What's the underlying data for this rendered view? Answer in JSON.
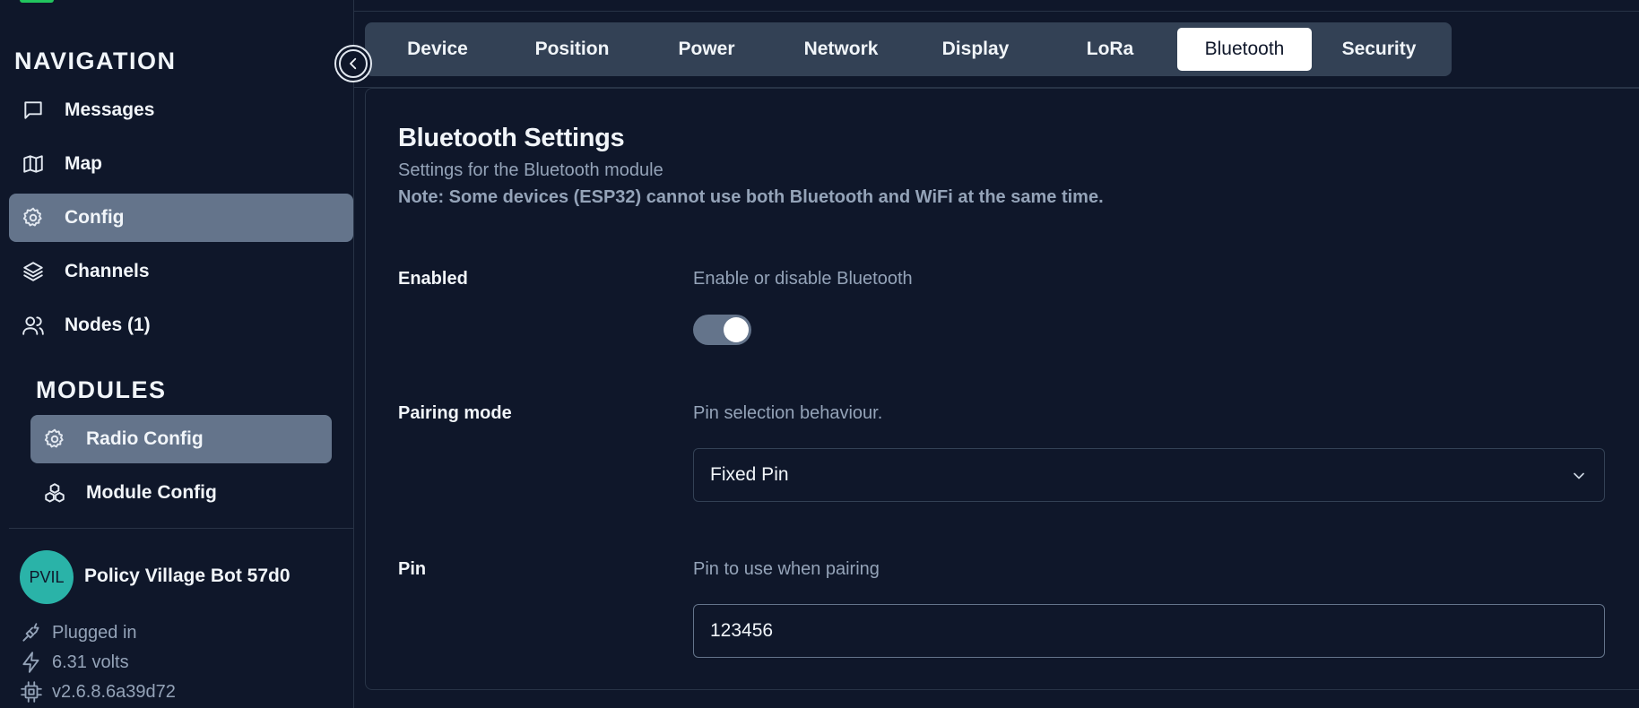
{
  "sidebar": {
    "navigation_title": "NAVIGATION",
    "nav_items": [
      {
        "label": "Messages",
        "icon": "message-square-icon"
      },
      {
        "label": "Map",
        "icon": "map-icon"
      },
      {
        "label": "Config",
        "icon": "gear-icon",
        "active": true
      },
      {
        "label": "Channels",
        "icon": "layers-icon"
      },
      {
        "label": "Nodes (1)",
        "icon": "users-icon"
      }
    ],
    "modules_title": "MODULES",
    "module_items": [
      {
        "label": "Radio Config",
        "icon": "gear-icon",
        "active": true
      },
      {
        "label": "Module Config",
        "icon": "boxes-icon"
      }
    ],
    "device": {
      "avatar_initials": "PVIL",
      "name": "Policy Village Bot 57d0",
      "power_status": "Plugged in",
      "voltage": "6.31 volts",
      "firmware": "v2.6.8.6a39d72"
    }
  },
  "tabs": [
    {
      "label": "Device"
    },
    {
      "label": "Position"
    },
    {
      "label": "Power"
    },
    {
      "label": "Network"
    },
    {
      "label": "Display"
    },
    {
      "label": "LoRa"
    },
    {
      "label": "Bluetooth",
      "active": true
    },
    {
      "label": "Security"
    }
  ],
  "settings": {
    "title": "Bluetooth Settings",
    "subtitle": "Settings for the Bluetooth module",
    "note": "Note: Some devices (ESP32) cannot use both Bluetooth and WiFi at the same time.",
    "fields": {
      "enabled": {
        "label": "Enabled",
        "description": "Enable or disable Bluetooth",
        "value": true
      },
      "pairing_mode": {
        "label": "Pairing mode",
        "description": "Pin selection behaviour.",
        "value": "Fixed Pin"
      },
      "pin": {
        "label": "Pin",
        "description": "Pin to use when pairing",
        "value": "123456"
      }
    }
  },
  "colors": {
    "background": "#0f172a",
    "active_item": "#64748b",
    "tabbar": "#334155",
    "avatar": "#2ab3a8"
  }
}
